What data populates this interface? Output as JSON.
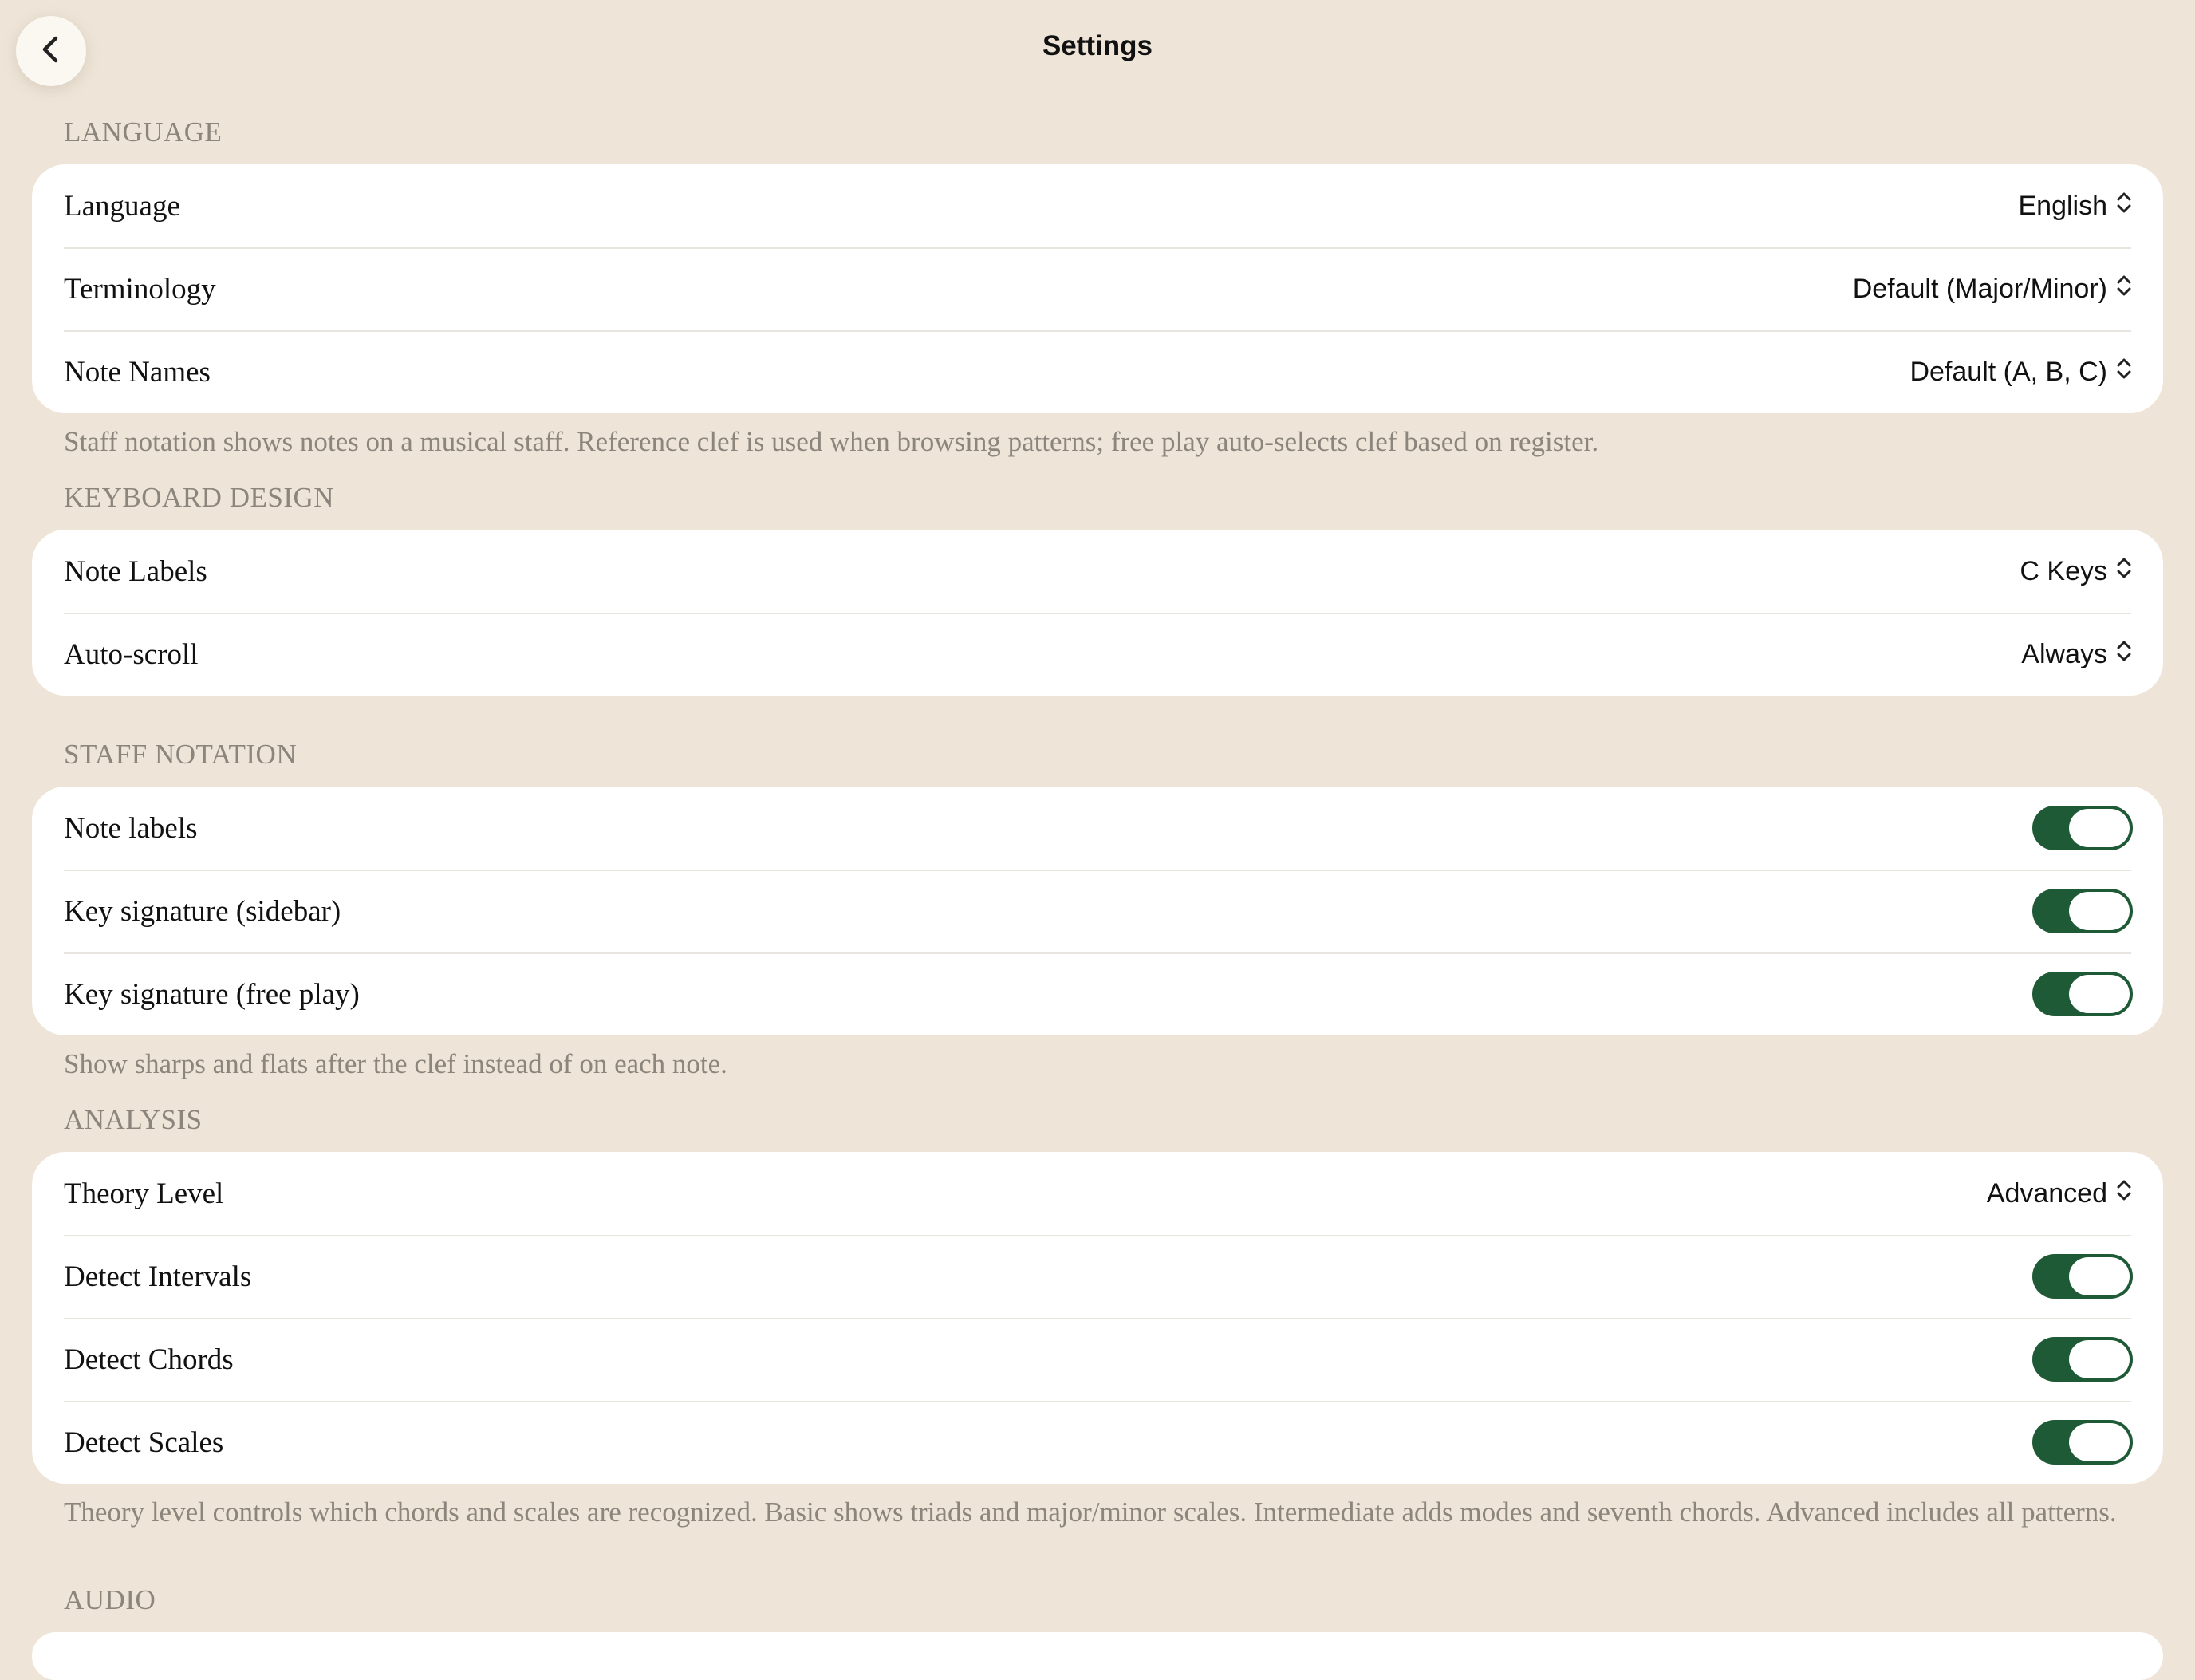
{
  "header": {
    "title": "Settings"
  },
  "sections": [
    {
      "header": "LANGUAGE",
      "rows": [
        {
          "label": "Language",
          "value": "English"
        },
        {
          "label": "Terminology",
          "value": "Default (Major/Minor)"
        },
        {
          "label": "Note Names",
          "value": "Default (A, B, C)"
        }
      ],
      "footer": "Staff notation shows notes on a musical staff. Reference clef is used when browsing patterns; free play auto-selects clef based on register."
    },
    {
      "header": "KEYBOARD DESIGN",
      "rows": [
        {
          "label": "Note Labels",
          "value": "C Keys"
        },
        {
          "label": "Auto-scroll",
          "value": "Always"
        }
      ]
    },
    {
      "header": "STAFF NOTATION",
      "rows": [
        {
          "label": "Note labels",
          "toggle": true
        },
        {
          "label": "Key signature (sidebar)",
          "toggle": true
        },
        {
          "label": "Key signature (free play)",
          "toggle": true
        }
      ],
      "footer": "Show sharps and flats after the clef instead of on each note."
    },
    {
      "header": "ANALYSIS",
      "rows": [
        {
          "label": "Theory Level",
          "value": "Advanced"
        },
        {
          "label": "Detect Intervals",
          "toggle": true
        },
        {
          "label": "Detect Chords",
          "toggle": true
        },
        {
          "label": "Detect Scales",
          "toggle": true
        }
      ],
      "footer": "Theory level controls which chords and scales are recognized. Basic shows triads and major/minor scales. Intermediate adds modes and seventh chords. Advanced includes all patterns."
    },
    {
      "header": "AUDIO"
    }
  ],
  "colors": {
    "background": "#EEE5D8",
    "toggle_on": "#1F5A36",
    "secondary_text": "#8C857C"
  },
  "icons": {
    "back": "chevron-left-icon",
    "picker": "chevron-up-down-icon"
  }
}
